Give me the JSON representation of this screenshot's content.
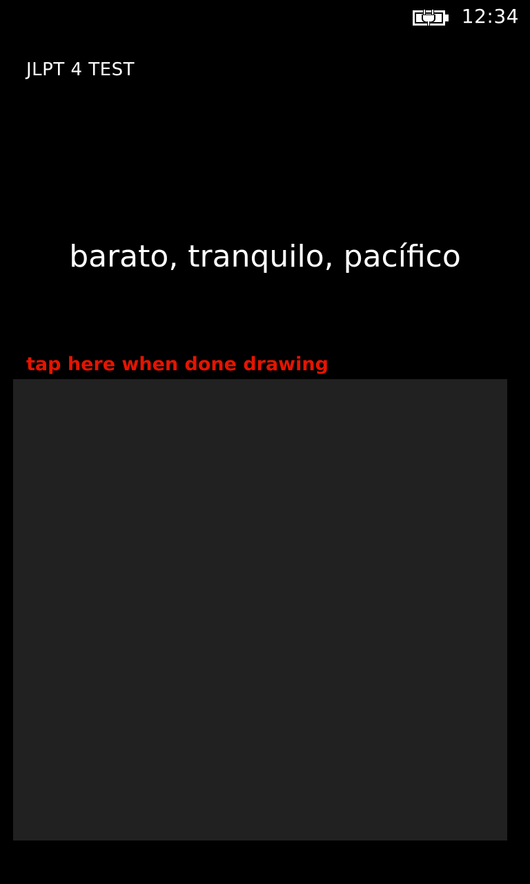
{
  "status_bar": {
    "time": "12:34",
    "battery_icon": "battery-charging-icon"
  },
  "app": {
    "title": "JLPT 4 TEST"
  },
  "question": {
    "meaning": "barato, tranquilo, pacífico"
  },
  "drawing": {
    "done_label": "tap here when done drawing",
    "canvas_color": "#212121"
  },
  "colors": {
    "background": "#000000",
    "accent": "#e51400",
    "text": "#ffffff"
  }
}
